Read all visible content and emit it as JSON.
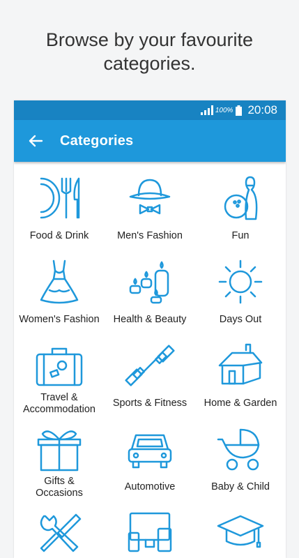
{
  "headline": {
    "line1": "Browse by your favourite",
    "line2": "categories."
  },
  "status_bar": {
    "battery_pct": "100%",
    "time": "20:08"
  },
  "app_bar": {
    "title": "Categories"
  },
  "colors": {
    "status_bar": "#1883c2",
    "app_bar": "#1e98db",
    "icon": "#1e98db"
  },
  "categories": [
    {
      "label": "Food & Drink",
      "icon": "plate-fork-knife-icon"
    },
    {
      "label": "Men's Fashion",
      "icon": "bowler-hat-bowtie-icon"
    },
    {
      "label": "Fun",
      "icon": "bowling-icon"
    },
    {
      "label": "Women's Fashion",
      "icon": "dress-icon"
    },
    {
      "label": "Health & Beauty",
      "icon": "candles-icon"
    },
    {
      "label": "Days Out",
      "icon": "sun-icon"
    },
    {
      "label": "Travel &\nAccommodation",
      "icon": "suitcase-icon"
    },
    {
      "label": "Sports & Fitness",
      "icon": "dumbbell-icon"
    },
    {
      "label": "Home & Garden",
      "icon": "house-icon"
    },
    {
      "label": "Gifts &\nOccasions",
      "icon": "gift-icon"
    },
    {
      "label": "Automotive",
      "icon": "car-icon"
    },
    {
      "label": "Baby & Child",
      "icon": "pram-icon"
    },
    {
      "label": "",
      "icon": "wrench-screwdriver-icon"
    },
    {
      "label": "",
      "icon": "devices-icon"
    },
    {
      "label": "",
      "icon": "graduation-cap-icon"
    }
  ]
}
